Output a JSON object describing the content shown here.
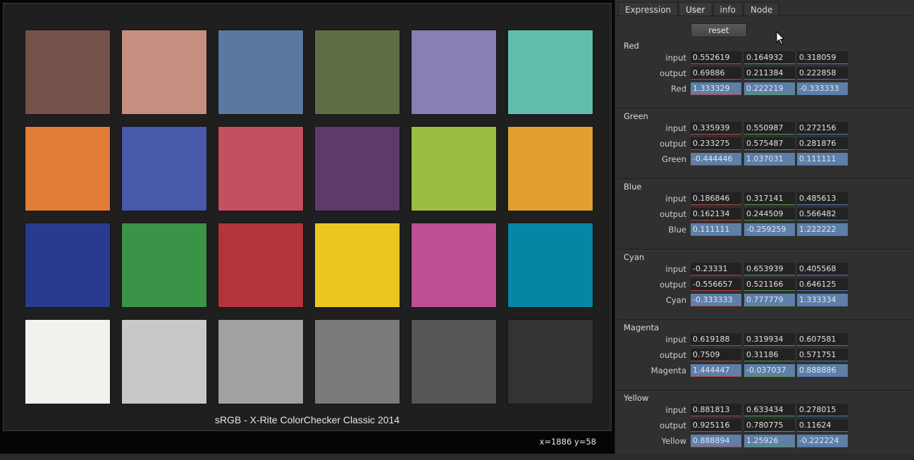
{
  "viewer": {
    "title": "sRGB - X-Rite ColorChecker Classic 2014",
    "coords": "x=1886 y=58",
    "swatches": [
      [
        "#76504a",
        "#c68e81",
        "#5a78a0",
        "#5f6e45",
        "#8680b3",
        "#5fbeab"
      ],
      [
        "#e27c36",
        "#4759a8",
        "#c3505f",
        "#5e396b",
        "#9dbc42",
        "#e2a12f"
      ],
      [
        "#293b8f",
        "#3a9447",
        "#b3353b",
        "#eac61f",
        "#bd5095",
        "#0586a5"
      ],
      [
        "#f1f1ed",
        "#c8c8c8",
        "#a0a1a0",
        "#7a7a7a",
        "#555655",
        "#333333"
      ]
    ]
  },
  "panel": {
    "tabs": [
      "Expression",
      "User",
      "info",
      "Node"
    ],
    "active_tab": "User",
    "reset_label": "reset",
    "row_labels": {
      "input": "input",
      "output": "output"
    },
    "groups": [
      {
        "name": "Red",
        "input": [
          "0.552619",
          "0.164932",
          "0.318059"
        ],
        "output": [
          "0.69886",
          "0.211384",
          "0.222858"
        ],
        "value": [
          "1.333329",
          "0.222219",
          "-0.333333"
        ]
      },
      {
        "name": "Green",
        "input": [
          "0.335939",
          "0.550987",
          "0.272156"
        ],
        "output": [
          "0.233275",
          "0.575487",
          "0.281876"
        ],
        "value": [
          "-0.444446",
          "1.037031",
          "0.111111"
        ]
      },
      {
        "name": "Blue",
        "input": [
          "0.186846",
          "0.317141",
          "0.485613"
        ],
        "output": [
          "0.162134",
          "0.244509",
          "0.566482"
        ],
        "value": [
          "0.111111",
          "-0.259259",
          "1.222222"
        ]
      },
      {
        "name": "Cyan",
        "input": [
          "-0.23331",
          "0.653939",
          "0.405568"
        ],
        "output": [
          "-0.556657",
          "0.521166",
          "0.646125"
        ],
        "value": [
          "-0.333333",
          "0.777779",
          "1.333334"
        ]
      },
      {
        "name": "Magenta",
        "input": [
          "0.619188",
          "0.319934",
          "0.607581"
        ],
        "output": [
          "0.7509",
          "0.31186",
          "0.571751"
        ],
        "value": [
          "1.444447",
          "-0.037037",
          "0.888886"
        ]
      },
      {
        "name": "Yellow",
        "input": [
          "0.881813",
          "0.633434",
          "0.278015"
        ],
        "output": [
          "0.925116",
          "0.780775",
          "0.11624"
        ],
        "value": [
          "0.888894",
          "1.25926",
          "-0.222224"
        ]
      }
    ]
  }
}
